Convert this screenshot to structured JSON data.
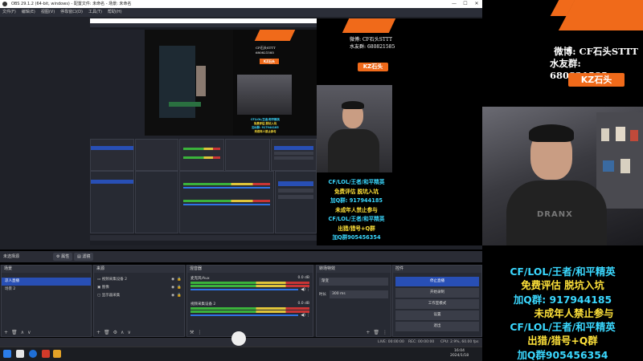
{
  "window": {
    "title": "OBS 29.1.2 (64-bit, windows) - 配置文件: 未命名 - 场景: 未命名"
  },
  "menu": [
    "文件(F)",
    "编辑(E)",
    "视图(V)",
    "停靠窗口(D)",
    "工具(T)",
    "帮助(H)"
  ],
  "dock_bar": {
    "label": "未选择源",
    "buttons": [
      "属性",
      "滤镜"
    ]
  },
  "scenes": {
    "header": "场景",
    "items": [
      "凉人直播",
      "场景 2"
    ]
  },
  "sources": {
    "header": "来源",
    "items": [
      "视频采集设备 2",
      "图像",
      "显示器采集"
    ]
  },
  "mixer": {
    "header": "混音器",
    "channels": [
      {
        "name": "麦克风/Aux",
        "level": "0.0 dB"
      },
      {
        "name": "视频采集设备 2",
        "level": "0.0 dB"
      }
    ]
  },
  "transitions": {
    "header": "转场特效",
    "type": "渐变",
    "duration_label": "时长",
    "duration": "300 ms"
  },
  "controls": {
    "header": "控件",
    "buttons": [
      "停止直播",
      "开始录制",
      "工作室模式",
      "设置",
      "退出"
    ]
  },
  "status": {
    "live": "LIVE: 00:00:00",
    "rec": "REC: 00:00:00",
    "cpu": "CPU: 2.9%, 60.00 fps"
  },
  "taskbar": {
    "time": "16:04",
    "date": "2024/1/18"
  },
  "overlay": {
    "weibo_label": "微博:",
    "weibo_value": "CF石头STTT",
    "youfen_label": "水友群:",
    "youfen_value": "680821585",
    "kz_badge": "KZ石头",
    "lines": [
      {
        "text": "CF/LOL/王者/和平精英",
        "color": "#3ad8ff"
      },
      {
        "text": "免费评估  脱坑入坑",
        "color": "#ffe23a"
      },
      {
        "text": "加Q群: 917944185",
        "color": "#3ad8ff"
      },
      {
        "text": "未成年人禁止参与",
        "color": "#ffe23a"
      },
      {
        "text": "CF/LOL/王者/和平精英",
        "color": "#3ad8ff"
      },
      {
        "text": "出猎/猎号+Q群",
        "color": "#ffe23a"
      },
      {
        "text": "加Q群905456354",
        "color": "#3ad8ff"
      }
    ],
    "tshirt": "DRANX"
  },
  "colors": {
    "accent_orange": "#f06a1a",
    "selection_blue": "#284fb5",
    "text_cyan": "#3ad8ff",
    "text_yellow": "#ffe23a"
  }
}
